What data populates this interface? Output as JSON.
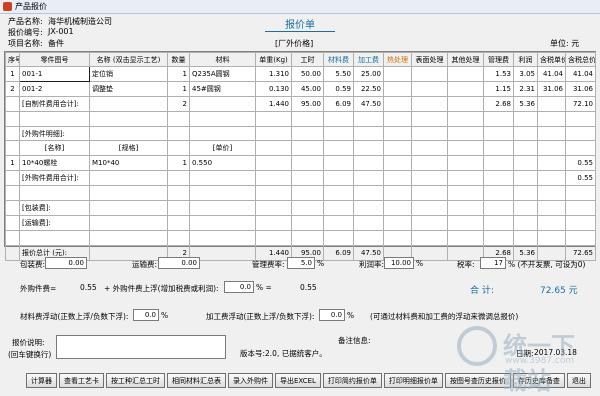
{
  "window": {
    "title": "产品报价"
  },
  "header": {
    "company_label": "产品名称:",
    "company": "海华机械制造公司",
    "quote_no_label": "报价编号:",
    "quote_no": "JX-001",
    "project_label": "项目名称:",
    "project": "备件",
    "title": "报价单",
    "price_type": "[厂外价格]",
    "unit": "单位: 元"
  },
  "columns": [
    "序号",
    "零件图号",
    "名称 (双击显示工艺)",
    "数量",
    "材料",
    "单重(Kg)",
    "工时",
    "材料费",
    "加工费",
    "热处理",
    "表面处理",
    "其他处理",
    "管理费",
    "利润",
    "含税单价",
    "含税总价"
  ],
  "rows": [
    [
      "1",
      "001-1",
      "定位销",
      "1",
      "Q235A圆钢",
      "1.310",
      "50.00",
      "5.50",
      "25.00",
      "",
      "",
      "",
      "1.53",
      "3.05",
      "41.04",
      "41.04"
    ],
    [
      "2",
      "001-2",
      "调整垫",
      "1",
      "45#圆钢",
      "0.130",
      "45.00",
      "0.59",
      "22.50",
      "",
      "",
      "",
      "1.15",
      "2.31",
      "31.06",
      "31.06"
    ],
    [
      "",
      "[自制件费用合计]:",
      "",
      "2",
      "",
      "1.440",
      "95.00",
      "6.09",
      "47.50",
      "",
      "",
      "",
      "2.68",
      "5.36",
      "",
      "72.10"
    ],
    [
      "",
      "",
      "",
      "",
      "",
      "",
      "",
      "",
      "",
      "",
      "",
      "",
      "",
      "",
      "",
      ""
    ],
    [
      "",
      "[外购件明细]:",
      "",
      "",
      "",
      "",
      "",
      "",
      "",
      "",
      "",
      "",
      "",
      "",
      "",
      ""
    ],
    [
      "",
      "[名称]",
      "[规格]",
      "",
      "[单价]",
      "",
      "",
      "",
      "",
      "",
      "",
      "",
      "",
      "",
      "",
      ""
    ],
    [
      "1",
      "10*40螺栓",
      "M10*40",
      "1",
      "0.550",
      "",
      "",
      "",
      "",
      "",
      "",
      "",
      "",
      "",
      "",
      "0.55"
    ],
    [
      "",
      "[外购件费用合计]:",
      "",
      "",
      "",
      "",
      "",
      "",
      "",
      "",
      "",
      "",
      "",
      "",
      "",
      "0.55"
    ],
    [
      "",
      "",
      "",
      "",
      "",
      "",
      "",
      "",
      "",
      "",
      "",
      "",
      "",
      "",
      "",
      ""
    ],
    [
      "",
      "[包装费]:",
      "",
      "",
      "",
      "",
      "",
      "",
      "",
      "",
      "",
      "",
      "",
      "",
      "",
      ""
    ],
    [
      "",
      "[运输费]:",
      "",
      "",
      "",
      "",
      "",
      "",
      "",
      "",
      "",
      "",
      "",
      "",
      "",
      ""
    ],
    [
      "",
      "",
      "",
      "",
      "",
      "",
      "",
      "",
      "",
      "",
      "",
      "",
      "",
      "",
      "",
      ""
    ],
    [
      "",
      "报价总计 (元):",
      "",
      "2",
      "",
      "1.440",
      "95.00",
      "6.09",
      "47.50",
      "",
      "",
      "",
      "2.68",
      "5.36",
      "",
      "72.65"
    ]
  ],
  "form": {
    "packing_label": "包装费:",
    "packing": "0.00",
    "transport_label": "运输费:",
    "transport": "0.00",
    "mgmt_label": "管理费率:",
    "mgmt": "5.0",
    "pct": "%",
    "profit_label": "利润率:",
    "profit": "10.00",
    "tax_label": "税率:",
    "tax": "17",
    "tax_note": "% (不开发票, 可设为0)",
    "outsource_label": "外购件费=",
    "outsource": "0.55",
    "float_label": "+ 外购件费上浮(增加税费或利润):",
    "float": "0.0",
    "pct_eq": "% =",
    "float_result": "0.55",
    "total_label": "合 计:",
    "total": "72.65 元",
    "mat_float_label": "材料费浮动(正数上浮/负数下浮):",
    "mat_float": "0.0",
    "proc_float_label": "加工费浮动(正数上浮/负数下浮):",
    "proc_float": "0.0",
    "float_note": "(可通过材料费和加工费的浮动来微调总报价)",
    "desc_label": "报价说明:",
    "desc_sub": "(回车键换行)",
    "remark_label": "备注信息:",
    "version": "版本号:2.0, 已据统客户。",
    "date_label": "日期:",
    "date": "2017.03.18"
  },
  "buttons": [
    "计算器",
    "查看工艺卡",
    "按工种汇总工时",
    "相同材料汇总表",
    "录入外购件",
    "导出EXCEL",
    "打印简约报价单",
    "打印明细报价单",
    "按图号查历史报价",
    "存历史库备查",
    "退出"
  ],
  "watermark": {
    "text": "统一下载站",
    "url": "www.3987.com"
  }
}
